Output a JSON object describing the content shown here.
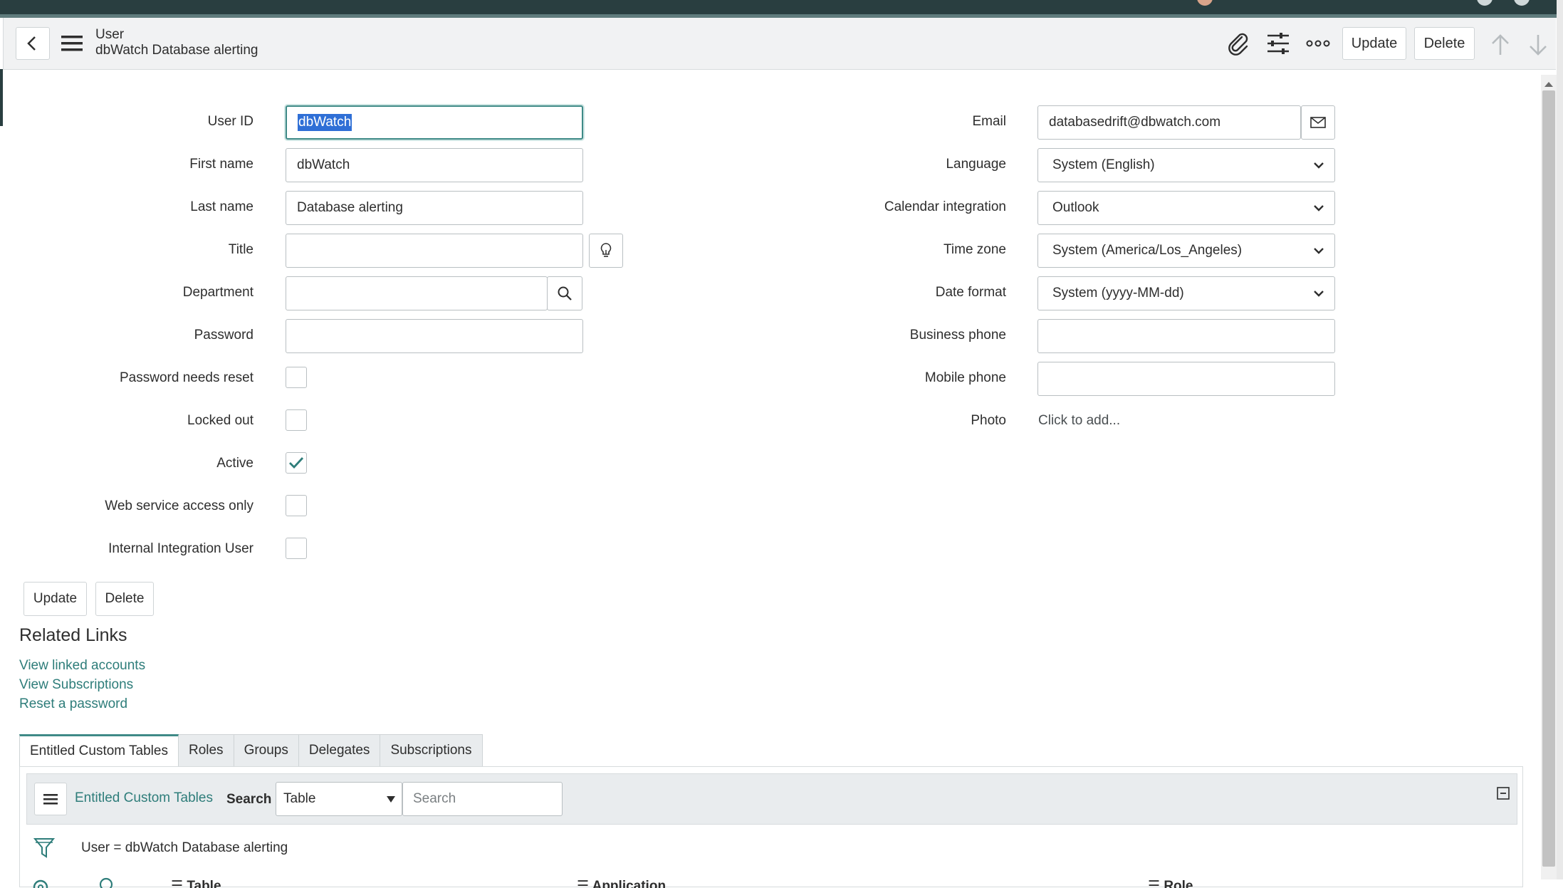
{
  "header": {
    "record_type": "User",
    "record_name": "dbWatch Database alerting",
    "update_label": "Update",
    "delete_label": "Delete"
  },
  "form": {
    "left": [
      {
        "label": "User ID",
        "value": "dbWatch"
      },
      {
        "label": "First name",
        "value": "dbWatch"
      },
      {
        "label": "Last name",
        "value": "Database alerting"
      },
      {
        "label": "Title",
        "value": ""
      },
      {
        "label": "Department",
        "value": ""
      },
      {
        "label": "Password",
        "value": ""
      }
    ],
    "checkboxes": [
      {
        "label": "Password needs reset",
        "checked": false
      },
      {
        "label": "Locked out",
        "checked": false
      },
      {
        "label": "Active",
        "checked": true
      },
      {
        "label": "Web service access only",
        "checked": false
      },
      {
        "label": "Internal Integration User",
        "checked": false
      }
    ],
    "right": [
      {
        "label": "Email",
        "value": "databasedrift@dbwatch.com"
      },
      {
        "label": "Language",
        "value": "System (English)"
      },
      {
        "label": "Calendar integration",
        "value": "Outlook"
      },
      {
        "label": "Time zone",
        "value": "System (America/Los_Angeles)"
      },
      {
        "label": "Date format",
        "value": "System (yyyy-MM-dd)"
      },
      {
        "label": "Business phone",
        "value": ""
      },
      {
        "label": "Mobile phone",
        "value": ""
      },
      {
        "label": "Photo",
        "value": "Click to add..."
      }
    ],
    "update_label": "Update",
    "delete_label": "Delete"
  },
  "related_links": {
    "title": "Related Links",
    "links": [
      "View linked accounts",
      "View Subscriptions",
      "Reset a password"
    ]
  },
  "related_tabs": [
    "Entitled Custom Tables",
    "Roles",
    "Groups",
    "Delegates",
    "Subscriptions"
  ],
  "list": {
    "title": "Entitled Custom Tables",
    "search_label": "Search",
    "search_field": "Table",
    "search_placeholder": "Search",
    "filter_text": "User = dbWatch Database alerting",
    "columns": [
      "Table",
      "Application",
      "Role"
    ]
  },
  "colors": {
    "brand_dark": "#293e40",
    "accent": "#3f8a87",
    "link": "#2e7d7a"
  }
}
